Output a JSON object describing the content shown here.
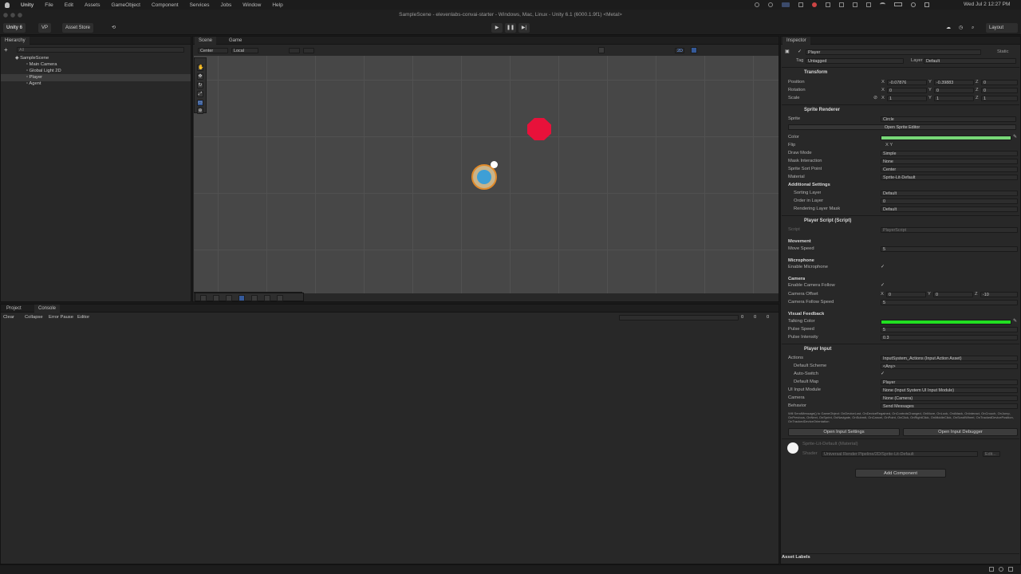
{
  "menubar": {
    "apple": "",
    "app": "Unity",
    "items": [
      "File",
      "Edit",
      "Assets",
      "GameObject",
      "Component",
      "Services",
      "Jobs",
      "Window",
      "Help"
    ],
    "clock": "Wed Jul 2  12:27 PM"
  },
  "window": {
    "title": "SampleScene - elevenlabs-convai-starter - Windows, Mac, Linux - Unity 6.1 (6000.1.9f1) <Metal>"
  },
  "toolbar": {
    "account": "Unity 6",
    "vp": "VP",
    "asset_store": "Asset Store",
    "layout": "Layout"
  },
  "hierarchy": {
    "tab": "Hierarchy",
    "scene": "SampleScene",
    "items": [
      "Main Camera",
      "Global Light 2D",
      "Player",
      "Agent"
    ],
    "search_placeholder": "All"
  },
  "scene_view": {
    "tabs": [
      "Scene",
      "Game"
    ],
    "pivot": "Center",
    "space": "Local",
    "mode_2d": "2D"
  },
  "bottom": {
    "tabs": [
      "Project",
      "Console"
    ],
    "buttons": [
      "Clear",
      "Collapse",
      "Error Pause",
      "Editor"
    ],
    "counts": [
      "0",
      "0",
      "0"
    ]
  },
  "inspector": {
    "tab": "Inspector",
    "object_name": "Player",
    "static": "Static",
    "tag_label": "Tag",
    "tag_value": "Untagged",
    "layer_label": "Layer",
    "layer_value": "Default",
    "transform": {
      "title": "Transform",
      "position_label": "Position",
      "position": [
        "-0.07876",
        "-0.39883",
        "0"
      ],
      "rotation_label": "Rotation",
      "rotation": [
        "0",
        "0",
        "0"
      ],
      "scale_label": "Scale",
      "scale": [
        "1",
        "1",
        "1"
      ]
    },
    "sprite_renderer": {
      "title": "Sprite Renderer",
      "sprite_label": "Sprite",
      "sprite_value": "Circle",
      "open_editor": "Open Sprite Editor",
      "color_label": "Color",
      "color": "#78d878",
      "flip_label": "Flip",
      "flip_value": "X   Y",
      "draw_mode_label": "Draw Mode",
      "draw_mode": "Simple",
      "mask_label": "Mask Interaction",
      "mask": "None",
      "sort_point_label": "Sprite Sort Point",
      "sort_point": "Center",
      "material_label": "Material",
      "material": "Sprite-Lit-Default",
      "additional": "Additional Settings",
      "sorting_layer_label": "Sorting Layer",
      "sorting_layer": "Default",
      "order_label": "Order in Layer",
      "order": "0",
      "rlm_label": "Rendering Layer Mask",
      "rlm": "Default"
    },
    "player_script": {
      "title": "Player Script (Script)",
      "script_label": "Script",
      "script_value": "PlayerScript",
      "movement": "Movement",
      "move_speed_label": "Move Speed",
      "move_speed": "5",
      "microphone": "Microphone",
      "enable_mic_label": "Enable Microphone",
      "camera": "Camera",
      "enable_follow_label": "Enable Camera Follow",
      "offset_label": "Camera Offset",
      "offset": [
        "0",
        "0",
        "-10"
      ],
      "follow_speed_label": "Camera Follow Speed",
      "follow_speed": "5",
      "visual": "Visual Feedback",
      "talking_color_label": "Talking Color",
      "talking_color": "#22e022",
      "pulse_speed_label": "Pulse Speed",
      "pulse_speed": "5",
      "pulse_intensity_label": "Pulse Intensity",
      "pulse_intensity": "0.3"
    },
    "player_input": {
      "title": "Player Input",
      "actions_label": "Actions",
      "actions": "InputSystem_Actions (Input Action Asset)",
      "scheme_label": "Default Scheme",
      "scheme": "<Any>",
      "auto_label": "Auto-Switch",
      "map_label": "Default Map",
      "map": "Player",
      "ui_label": "UI Input Module",
      "ui": "None (Input System UI Input Module)",
      "camera_label": "Camera",
      "camera": "None (Camera)",
      "behavior_label": "Behavior",
      "behavior": "Send Messages",
      "info": "Will SendMessage() to GameObject: OnDeviceLost, OnDeviceRegained, OnControlsChanged, OnMove, OnLook, OnAttack, OnInteract, OnCrouch, OnJump, OnPrevious, OnNext, OnSprint, OnNavigate, OnSubmit, OnCancel, OnPoint, OnClick, OnRightClick, OnMiddleClick, OnScrollWheel, OnTrackedDevicePosition, OnTrackedDeviceOrientation",
      "open_settings": "Open Input Settings",
      "open_debugger": "Open Input Debugger"
    },
    "material": {
      "name": "Sprite-Lit-Default (Material)",
      "shader_label": "Shader",
      "shader": "Universal Render Pipeline/2D/Sprite-Lit-Default",
      "edit": "Edit..."
    },
    "add_component": "Add Component",
    "asset_labels": "Asset Labels"
  }
}
